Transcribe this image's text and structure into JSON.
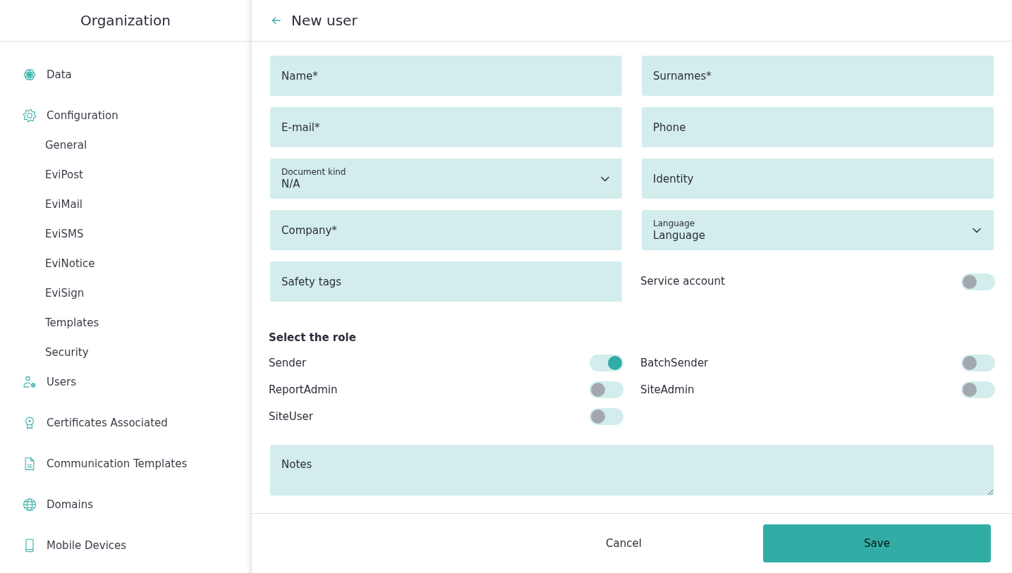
{
  "sidebar": {
    "title": "Organization",
    "items": [
      {
        "label": "Data"
      },
      {
        "label": "Configuration",
        "children": [
          {
            "label": "General"
          },
          {
            "label": "EviPost"
          },
          {
            "label": "EviMail"
          },
          {
            "label": "EviSMS"
          },
          {
            "label": "EviNotice"
          },
          {
            "label": "EviSign"
          },
          {
            "label": "Templates"
          },
          {
            "label": "Security"
          }
        ]
      },
      {
        "label": "Users"
      },
      {
        "label": "Certificates Associated"
      },
      {
        "label": "Communication Templates"
      },
      {
        "label": "Domains"
      },
      {
        "label": "Mobile Devices"
      }
    ]
  },
  "header": {
    "title": "New user"
  },
  "form": {
    "fields": [
      {
        "kind": "input",
        "placeholder": "Name*"
      },
      {
        "kind": "input",
        "placeholder": "Surnames*"
      },
      {
        "kind": "input",
        "placeholder": "E-mail*"
      },
      {
        "kind": "input",
        "placeholder": "Phone"
      },
      {
        "kind": "select",
        "label": "Document kind",
        "value": "N/A"
      },
      {
        "kind": "input",
        "placeholder": "Identity"
      },
      {
        "kind": "input",
        "placeholder": "Company*"
      },
      {
        "kind": "select",
        "label": "Language",
        "value": "Language"
      },
      {
        "kind": "input",
        "placeholder": "Safety tags"
      },
      {
        "kind": "switch",
        "label": "Service account",
        "checked": false
      }
    ],
    "roles": {
      "title": "Select the role",
      "items": [
        {
          "label": "Sender",
          "checked": true
        },
        {
          "label": "BatchSender",
          "checked": false
        },
        {
          "label": "ReportAdmin",
          "checked": false
        },
        {
          "label": "SiteAdmin",
          "checked": false
        },
        {
          "label": "SiteUser",
          "checked": false
        }
      ]
    },
    "notes": {
      "placeholder": "Notes"
    }
  },
  "footer": {
    "buttons": [
      {
        "kind": "secondary",
        "label": "Cancel"
      },
      {
        "kind": "primary",
        "label": "Save"
      }
    ]
  }
}
